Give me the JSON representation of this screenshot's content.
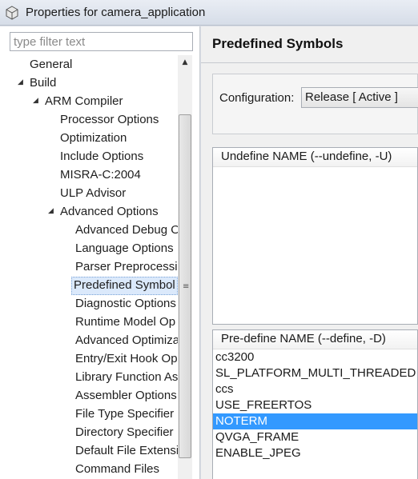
{
  "window": {
    "title": "Properties for camera_application"
  },
  "filter": {
    "placeholder": "type filter text"
  },
  "tree": {
    "general": "General",
    "build": "Build",
    "arm_compiler": "ARM Compiler",
    "processor_options": "Processor Options",
    "optimization": "Optimization",
    "include_options": "Include Options",
    "misra": "MISRA-C:2004",
    "ulp_advisor": "ULP Advisor",
    "advanced_options": "Advanced Options",
    "advanced_debug": "Advanced Debug O",
    "language_options": "Language Options",
    "parser_preprocessing": "Parser Preprocessin",
    "predefined_symbols": "Predefined Symbol",
    "diagnostic_options": "Diagnostic Options",
    "runtime_model": "Runtime Model Op",
    "advanced_optimiza": "Advanced Optimiza",
    "entry_exit_hook": "Entry/Exit Hook Op",
    "library_function": "Library Function As",
    "assembler_options": "Assembler Options",
    "file_type_specifier": "File Type Specifier",
    "directory_specifier": "Directory Specifier",
    "default_file_extensi": "Default File Extensi",
    "command_files": "Command Files"
  },
  "page": {
    "title": "Predefined Symbols"
  },
  "configuration": {
    "label": "Configuration:",
    "value": "Release  [ Active ]"
  },
  "undefine": {
    "header": "Undefine NAME (--undefine, -U)"
  },
  "predefine": {
    "header": "Pre-define NAME (--define, -D)",
    "items": [
      "cc3200",
      "SL_PLATFORM_MULTI_THREADED",
      "ccs",
      "USE_FREERTOS",
      "NOTERM",
      "QVGA_FRAME",
      "ENABLE_JPEG"
    ],
    "selected_index": 4
  },
  "colors": {
    "selection": "#3399ff",
    "tree_selection": "#dbe9fb"
  }
}
